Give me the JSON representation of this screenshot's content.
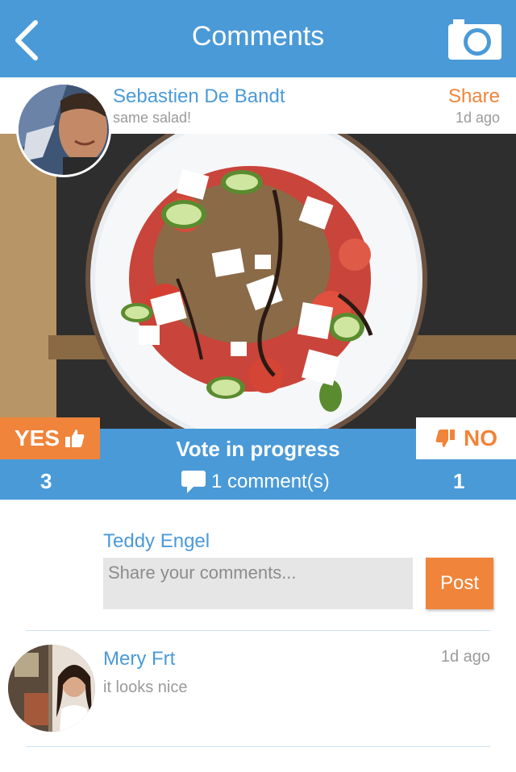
{
  "header": {
    "title": "Comments",
    "back_icon": "chevron-left-icon",
    "camera_icon": "camera-icon"
  },
  "post": {
    "author": "Sebastien De Bandt",
    "caption": "same salad!",
    "share_label": "Share",
    "time": "1d ago"
  },
  "vote": {
    "yes_label": "YES",
    "no_label": "NO",
    "status": "Vote in progress",
    "yes_count": "3",
    "no_count": "1",
    "comments_label": "1 comment(s)"
  },
  "composer": {
    "user": "Teddy Engel",
    "placeholder": "Share your comments...",
    "value": "",
    "post_label": "Post"
  },
  "comments": [
    {
      "author": "Mery Frt",
      "text": "it looks nice",
      "time": "1d ago"
    }
  ],
  "colors": {
    "primary_blue": "#4a9ad8",
    "accent_orange": "#f0843a",
    "muted_text": "#9a9a9a",
    "input_bg": "#e6e6e6"
  }
}
